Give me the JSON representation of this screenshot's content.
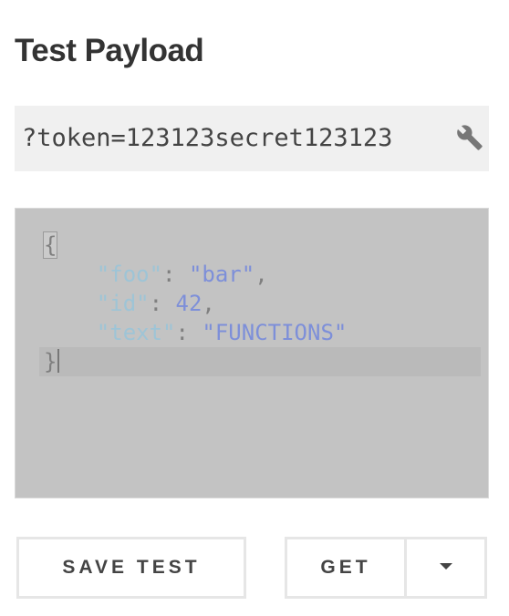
{
  "panel": {
    "title": "Test Payload"
  },
  "query": {
    "value": "?token=123123secret123123",
    "settings_icon": "wrench-icon"
  },
  "payload": {
    "lines": {
      "open_brace": "{",
      "indent": "    ",
      "foo_key": "\"foo\"",
      "foo_value": "\"bar\"",
      "id_key": "\"id\"",
      "id_value": "42",
      "text_key": "\"text\"",
      "text_value": "\"FUNCTIONS\"",
      "colon": ": ",
      "comma": ",",
      "close_brace": "}"
    }
  },
  "actions": {
    "save_label": "SAVE TEST",
    "method_label": "GET",
    "method_dropdown_icon": "caret-down-icon"
  },
  "colors": {
    "editor_bg": "#c3c3c3",
    "query_bg": "#f0f0f0",
    "json_key": "#9ec4d6",
    "json_value": "#7d8fd9",
    "button_border": "#e6e6e6"
  }
}
